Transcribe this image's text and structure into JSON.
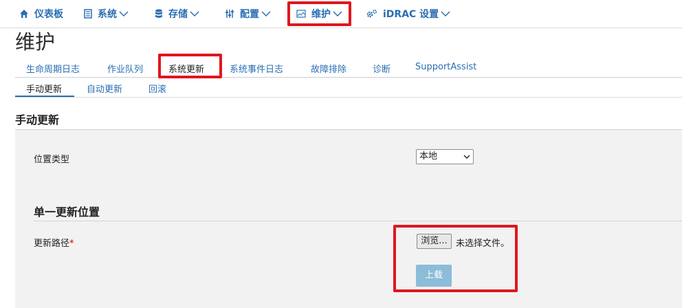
{
  "topnav": {
    "items": [
      {
        "label": "仪表板",
        "icon": "home-icon"
      },
      {
        "label": "系统",
        "icon": "server-icon"
      },
      {
        "label": "存储",
        "icon": "database-icon"
      },
      {
        "label": "配置",
        "icon": "sliders-icon"
      },
      {
        "label": "维护",
        "icon": "image-icon"
      },
      {
        "label": "iDRAC 设置",
        "icon": "gears-icon"
      }
    ]
  },
  "page": {
    "title": "维护"
  },
  "tabs": [
    "生命周期日志",
    "作业队列",
    "系统更新",
    "系统事件日志",
    "故障排除",
    "诊断",
    "SupportAssist"
  ],
  "subtabs": [
    "手动更新",
    "自动更新",
    "回滚"
  ],
  "manual_update": {
    "title": "手动更新",
    "location_type_label": "位置类型",
    "location_type_value": "本地",
    "single_location_title": "单一更新位置",
    "update_path_label": "更新路径",
    "required_marker": "*",
    "browse_label": "浏览...",
    "file_status": "未选择文件。",
    "upload_label": "上载"
  },
  "colors": {
    "link": "#2a6eb3",
    "highlight": "#e0161f",
    "upload_bg": "#8bbcd8",
    "panel_bg": "#f2f2f2"
  }
}
